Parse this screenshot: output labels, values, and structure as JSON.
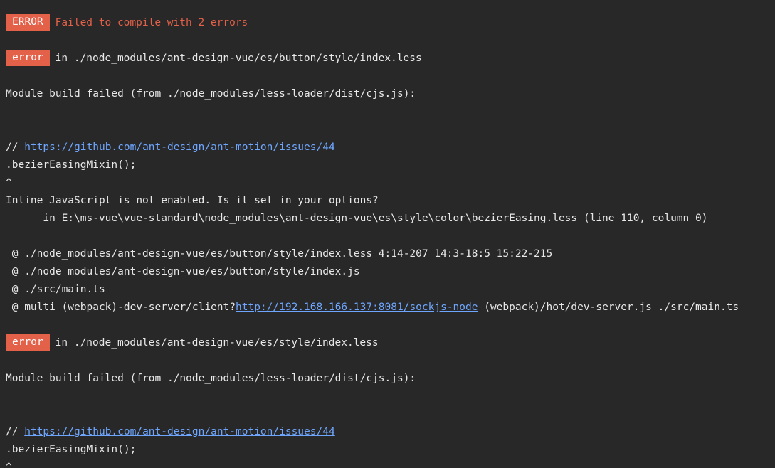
{
  "header": {
    "badge": "ERROR",
    "message": "Failed to compile with 2 errors"
  },
  "errors": [
    {
      "badge": "error",
      "location": "in ./node_modules/ant-design-vue/es/button/style/index.less",
      "build_failed": "Module build failed (from ./node_modules/less-loader/dist/cjs.js):",
      "comment_prefix": "// ",
      "comment_link": "https://github.com/ant-design/ant-motion/issues/44",
      "mixin_call": ".bezierEasingMixin();",
      "caret": "^",
      "inline_js_message": "Inline JavaScript is not enabled. Is it set in your options?",
      "in_file": "      in E:\\ms-vue\\vue-standard\\node_modules\\ant-design-vue\\es\\style\\color\\bezierEasing.less (line 110, column 0)",
      "trace": [
        " @ ./node_modules/ant-design-vue/es/button/style/index.less 4:14-207 14:3-18:5 15:22-215",
        " @ ./node_modules/ant-design-vue/es/button/style/index.js",
        " @ ./src/main.ts"
      ],
      "multi_prefix": " @ multi (webpack)-dev-server/client?",
      "multi_link": "http://192.168.166.137:8081/sockjs-node",
      "multi_suffix": " (webpack)/hot/dev-server.js ./src/main.ts"
    },
    {
      "badge": "error",
      "location": "in ./node_modules/ant-design-vue/es/style/index.less",
      "build_failed": "Module build failed (from ./node_modules/less-loader/dist/cjs.js):",
      "comment_prefix": "// ",
      "comment_link": "https://github.com/ant-design/ant-motion/issues/44",
      "mixin_call": ".bezierEasingMixin();",
      "caret": "^"
    }
  ],
  "colors": {
    "background": "#282828",
    "error_red": "#e36049",
    "link_blue": "#6ea6ff",
    "text": "#e8e8e8"
  }
}
